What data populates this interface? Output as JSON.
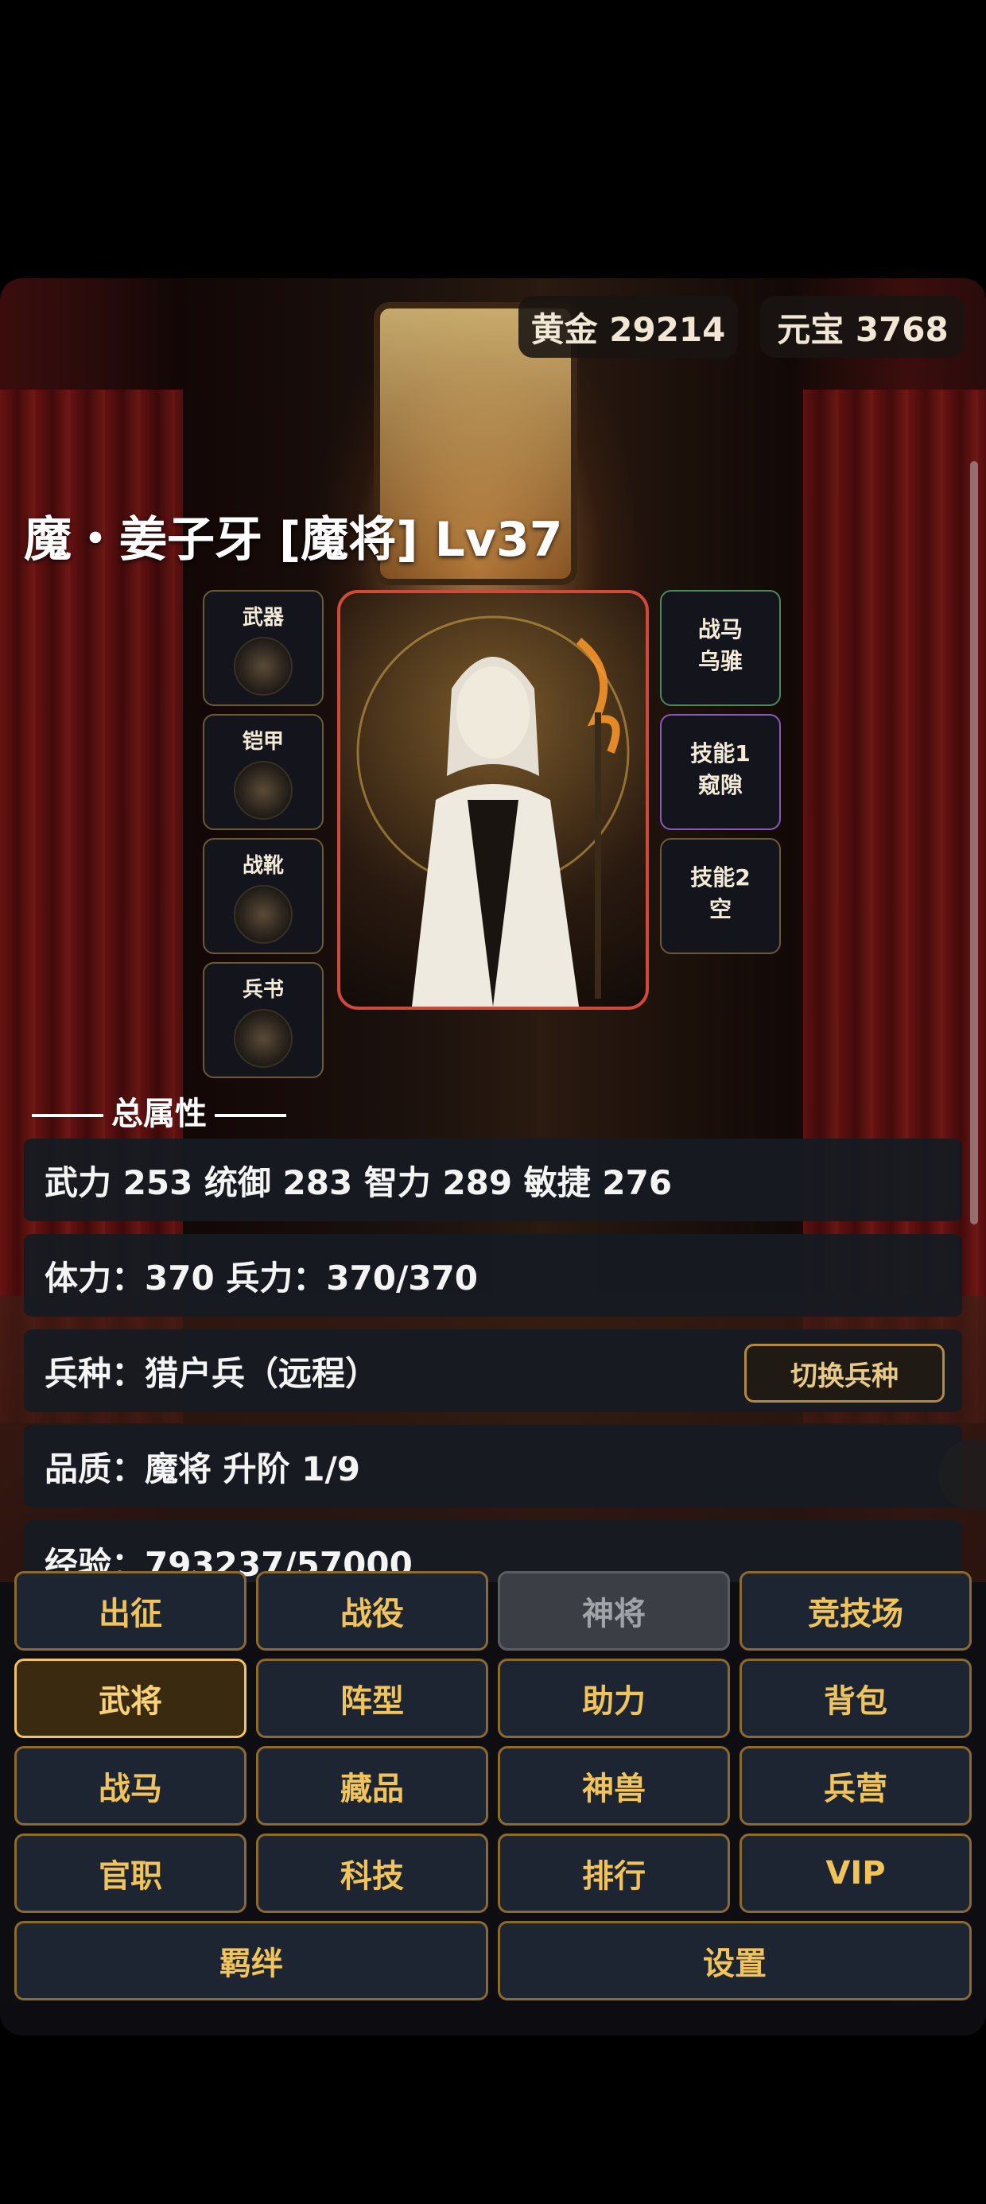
{
  "currency": {
    "gold_label": "黄金 29214",
    "yuanbao_label": "元宝 3768"
  },
  "hero": {
    "title": "魔・姜子牙 [魔将] Lv37"
  },
  "equipment_slots": [
    {
      "label": "武器"
    },
    {
      "label": "铠甲"
    },
    {
      "label": "战靴"
    },
    {
      "label": "兵书"
    }
  ],
  "right_slots": [
    {
      "label": "战马",
      "value": "乌骓"
    },
    {
      "label": "技能1",
      "value": "窥隙"
    },
    {
      "label": "技能2",
      "value": "空"
    }
  ],
  "attributes": {
    "section_title": "总属性",
    "stats_line": "武力 253  统御 283  智力 289  敏捷 276",
    "hp_line": "体力：370  兵力：370/370",
    "troop_line": "兵种：猎户兵（远程）",
    "switch_troop_button": "切换兵种",
    "quality_line": "品质：魔将  升阶 1/9",
    "exp_line": "经验：793237/57000"
  },
  "nav": {
    "row1": [
      "出征",
      "战役",
      "神将",
      "竞技场"
    ],
    "row2": [
      "武将",
      "阵型",
      "助力",
      "背包"
    ],
    "row3": [
      "战马",
      "藏品",
      "神兽",
      "兵营"
    ],
    "row4": [
      "官职",
      "科技",
      "排行",
      "VIP"
    ],
    "row5": [
      "羁绊",
      "设置"
    ]
  },
  "colors": {
    "accent_gold": "#f0c45a",
    "portrait_border": "#d04a3a",
    "panel_bg": "#1d2432"
  }
}
